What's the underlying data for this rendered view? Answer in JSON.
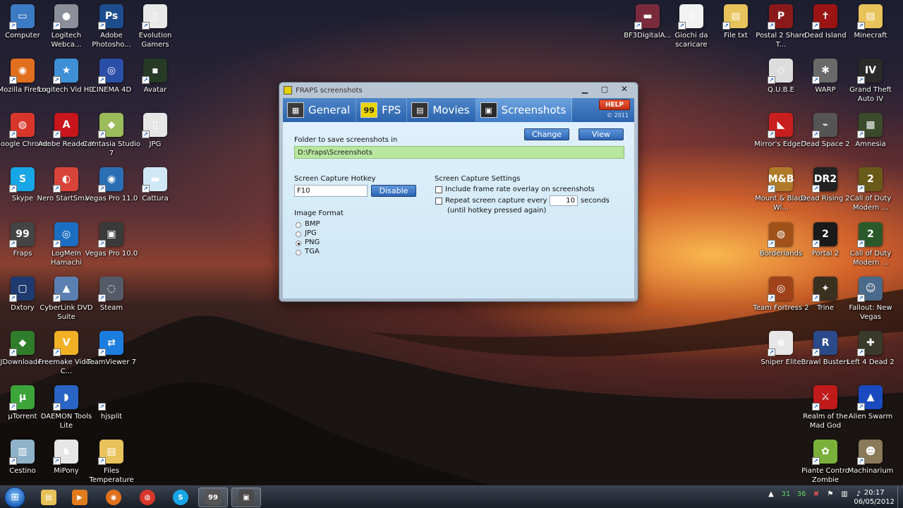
{
  "desktop": {
    "left_icons": [
      {
        "label": "Computer",
        "color": "#3d7ac4",
        "glyph": "▭"
      },
      {
        "label": "Logitech Webca...",
        "color": "#8a8f99",
        "glyph": "●"
      },
      {
        "label": "Adobe Photosho...",
        "color": "#1c4d8c",
        "glyph": "Ps"
      },
      {
        "label": "Evolution Gamers",
        "color": "#e8e8e8",
        "glyph": "▯"
      },
      {
        "label": "Mozilla Firefox",
        "color": "#e0701e",
        "glyph": "◉"
      },
      {
        "label": "Logitech Vid HD",
        "color": "#3e8fd6",
        "glyph": "★"
      },
      {
        "label": "CINEMA 4D",
        "color": "#2b4fa8",
        "glyph": "◎"
      },
      {
        "label": "Avatar",
        "color": "#263a26",
        "glyph": "▪"
      },
      {
        "label": "Google Chrome",
        "color": "#d9362b",
        "glyph": "◍"
      },
      {
        "label": "Adobe Reader X",
        "color": "#c8161c",
        "glyph": "A"
      },
      {
        "label": "Camtasia Studio 7",
        "color": "#9bbc5a",
        "glyph": "◆"
      },
      {
        "label": "JPG",
        "color": "#e6e6e6",
        "glyph": "▯"
      },
      {
        "label": "Skype",
        "color": "#17a6e6",
        "glyph": "S"
      },
      {
        "label": "Nero StartSma...",
        "color": "#d9443a",
        "glyph": "◐"
      },
      {
        "label": "Vegas Pro 11.0",
        "color": "#2a6fb3",
        "glyph": "◉"
      },
      {
        "label": "Cattura",
        "color": "#d0e8f6",
        "glyph": "▬"
      },
      {
        "label": "Fraps",
        "color": "#444444",
        "glyph": "99"
      },
      {
        "label": "LogMeIn Hamachi",
        "color": "#1c6ec2",
        "glyph": "◎"
      },
      {
        "label": "Vegas Pro 10.0",
        "color": "#3a3a3a",
        "glyph": "▣"
      },
      {
        "label": "Dxtory",
        "color": "#1f3a6e",
        "glyph": "▢"
      },
      {
        "label": "CyberLink DVD Suite",
        "color": "#5b7fb0",
        "glyph": "▲"
      },
      {
        "label": "Steam",
        "color": "#555b66",
        "glyph": "◌"
      },
      {
        "label": "JDownloader",
        "color": "#2f7d2a",
        "glyph": "◆"
      },
      {
        "label": "Freemake Video C...",
        "color": "#f2b125",
        "glyph": "V"
      },
      {
        "label": "TeamViewer 7",
        "color": "#1c7de0",
        "glyph": "⇄"
      },
      {
        "label": "µTorrent",
        "color": "#3da43a",
        "glyph": "µ"
      },
      {
        "label": "DAEMON Tools Lite",
        "color": "#2a64c4",
        "glyph": "◗"
      },
      {
        "label": "hjsplit",
        "color": "#00000000",
        "glyph": ""
      },
      {
        "label": "Cestino",
        "color": "#8fb2c8",
        "glyph": "▥"
      },
      {
        "label": "MiPony",
        "color": "#e6e6e6",
        "glyph": "♞"
      },
      {
        "label": "Files Temperature",
        "color": "#e8c25a",
        "glyph": "▤"
      }
    ],
    "right_icons": [
      {
        "label": "BF3DigitalA...",
        "color": "#7a2a3a",
        "glyph": "▬"
      },
      {
        "label": "Giochi da scaricare",
        "color": "#f2f2f2",
        "glyph": "▯"
      },
      {
        "label": "File txt",
        "color": "#e8c25a",
        "glyph": "▤"
      },
      {
        "label": "Postal 2 Share T...",
        "color": "#8a1a1a",
        "glyph": "P"
      },
      {
        "label": "Dead Island",
        "color": "#9a1414",
        "glyph": "✝"
      },
      {
        "label": "Minecraft",
        "color": "#e8c25a",
        "glyph": "▤"
      },
      {
        "label": "Q.U.B.E",
        "color": "#dddddd",
        "glyph": "◇"
      },
      {
        "label": "WARP",
        "color": "#6a6a6a",
        "glyph": "✱"
      },
      {
        "label": "Grand Theft Auto IV",
        "color": "#2a2a2a",
        "glyph": "IV"
      },
      {
        "label": "Mirror's Edge™",
        "color": "#c81e1e",
        "glyph": "◣"
      },
      {
        "label": "Dead Space 2",
        "color": "#555555",
        "glyph": "⌁"
      },
      {
        "label": "Amnesia",
        "color": "#3a4a2a",
        "glyph": "▦"
      },
      {
        "label": "Mount & Blade Wi...",
        "color": "#b07a2a",
        "glyph": "M&B"
      },
      {
        "label": "Dead Rising 2",
        "color": "#222222",
        "glyph": "DR2"
      },
      {
        "label": "Call of Duty Modern ...",
        "color": "#6a5a1a",
        "glyph": "2"
      },
      {
        "label": "Borderlands",
        "color": "#a0521a",
        "glyph": "◍"
      },
      {
        "label": "Portal 2",
        "color": "#1a1a1a",
        "glyph": "2"
      },
      {
        "label": "Call of Duty Modern ...",
        "color": "#2a5a2a",
        "glyph": "2"
      },
      {
        "label": "Team Fortress 2",
        "color": "#a0421a",
        "glyph": "◎"
      },
      {
        "label": "Trine",
        "color": "#3a3020",
        "glyph": "✦"
      },
      {
        "label": "Fallout: New Vegas",
        "color": "#4a6a8a",
        "glyph": "☺"
      },
      {
        "label": "Sniper Elite",
        "color": "#e6e6e6",
        "glyph": "⊕"
      },
      {
        "label": "Brawl Busters",
        "color": "#2a4a8a",
        "glyph": "R"
      },
      {
        "label": "Left 4 Dead 2",
        "color": "#3a3a2a",
        "glyph": "✚"
      },
      {
        "label": "Realm of the Mad God",
        "color": "#c01a1a",
        "glyph": "⚔"
      },
      {
        "label": "Alien Swarm",
        "color": "#1a4ac0",
        "glyph": "▲"
      },
      {
        "label": "Piante Contro Zombie",
        "color": "#7ab03a",
        "glyph": "✿"
      },
      {
        "label": "Machinarium",
        "color": "#8a7a5a",
        "glyph": "☻"
      }
    ]
  },
  "fraps": {
    "window_title": "FRAPS screenshots",
    "tabs": [
      {
        "label": "General",
        "glyph": "▦"
      },
      {
        "label": "FPS",
        "glyph": "99"
      },
      {
        "label": "Movies",
        "glyph": "▤"
      },
      {
        "label": "Screenshots",
        "glyph": "▣"
      }
    ],
    "help_label": "HELP",
    "copyright": "© 2011",
    "folder_label": "Folder to save screenshots in",
    "change_label": "Change",
    "view_label": "View",
    "folder_path": "D:\\Fraps\\Screenshots",
    "hotkey_label": "Screen Capture Hotkey",
    "hotkey_value": "F10",
    "disable_label": "Disable",
    "settings_label": "Screen Capture Settings",
    "overlay_label": "Include frame rate overlay on screenshots",
    "repeat_label": "Repeat screen capture every",
    "repeat_value": "10",
    "seconds_label": "seconds",
    "until_label": "(until hotkey pressed again)",
    "format_label": "Image Format",
    "formats": [
      "BMP",
      "JPG",
      "PNG",
      "TGA"
    ],
    "selected_format": "PNG",
    "colors": {
      "tab_bar": "#2b63ad",
      "panel": "#dff0fb",
      "field_green": "#b8e6a0",
      "help_red": "#d43a1e"
    }
  },
  "taskbar": {
    "time": "20:17",
    "date": "06/05/2012",
    "tray_values": [
      "31",
      "36"
    ]
  }
}
